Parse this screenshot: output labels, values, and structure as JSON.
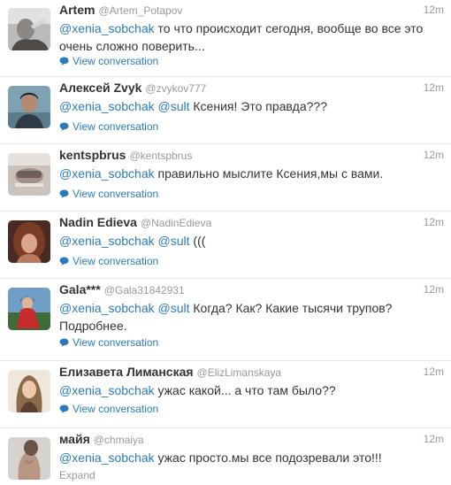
{
  "colors": {
    "link": "#2b7bb9",
    "meta": "#999999",
    "text": "#333333"
  },
  "tweets": [
    {
      "fullname": "Artem",
      "screen": "@Artem_Potapov",
      "time": "12m",
      "mentions": [
        "@xenia_sobchak"
      ],
      "line1": " то что происходит сегодня, вообще во все это",
      "line2": "очень сложно поверить...",
      "action": "View conversation",
      "avatar": "avatar-artem"
    },
    {
      "fullname": "Алексей Zvyk",
      "screen": "@zvykov777",
      "time": "12m",
      "mentions": [
        "@xenia_sobchak",
        "@sult"
      ],
      "line1": " Ксения! Это правда???",
      "line2": "",
      "action": "View conversation",
      "avatar": "avatar-aleksey"
    },
    {
      "fullname": "kentspbrus",
      "screen": "@kentspbrus",
      "time": "12m",
      "mentions": [
        "@xenia_sobchak"
      ],
      "line1": " правильно мыслите Ксения,мы с вами.",
      "line2": "",
      "action": "View conversation",
      "avatar": "avatar-kent"
    },
    {
      "fullname": "Nadin Edieva",
      "screen": "@NadinEdieva",
      "time": "12m",
      "mentions": [
        "@xenia_sobchak",
        "@sult"
      ],
      "line1": " (((",
      "line2": "",
      "action": "View conversation",
      "avatar": "avatar-nadin"
    },
    {
      "fullname": "Gala***",
      "screen": "@Gala31842931",
      "time": "12m",
      "mentions": [
        "@xenia_sobchak",
        "@sult"
      ],
      "line1": " Когда? Как? Какие тысячи трупов?",
      "line2": "Подробнее.",
      "action": "View conversation",
      "avatar": "avatar-gala"
    },
    {
      "fullname": "Елизавета Лиманская",
      "screen": "@ElizLimanskaya",
      "time": "12m",
      "mentions": [
        "@xenia_sobchak"
      ],
      "line1": " ужас какой... а что там было??",
      "line2": "",
      "action": "View conversation",
      "avatar": "avatar-elizaveta"
    },
    {
      "fullname": "майя",
      "screen": "@chmaiya",
      "time": "12m",
      "mentions": [
        "@xenia_sobchak"
      ],
      "line1": " ужас просто.мы все подозревали это!!!",
      "line2": "",
      "action": "Expand",
      "avatar": "avatar-maya"
    }
  ]
}
